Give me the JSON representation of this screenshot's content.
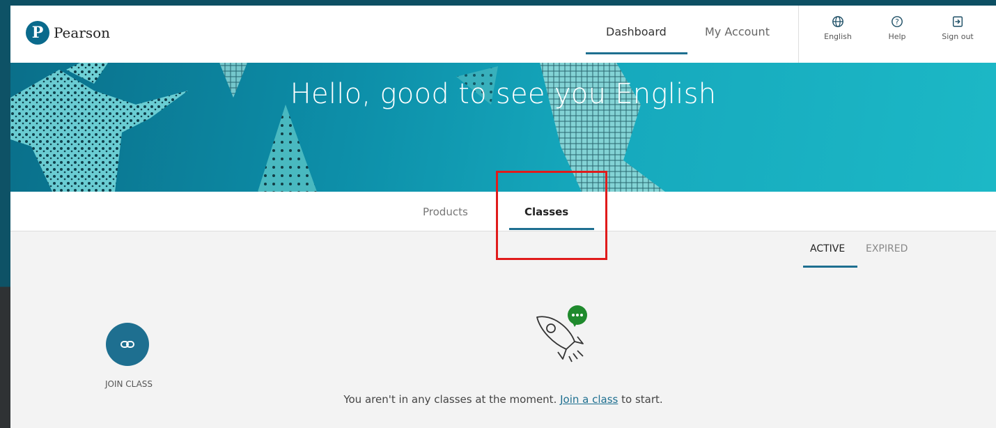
{
  "header": {
    "brand": "Pearson",
    "brand_letter": "P",
    "nav": {
      "dashboard": "Dashboard",
      "my_account": "My Account"
    },
    "utilities": {
      "language": "English",
      "help": "Help",
      "sign_out": "Sign out"
    }
  },
  "banner": {
    "greeting": "Hello, good to see you English"
  },
  "tabs": {
    "products": "Products",
    "classes": "Classes",
    "selected": "Classes"
  },
  "filters": {
    "active": "ACTIVE",
    "expired": "EXPIRED",
    "selected": "ACTIVE"
  },
  "join": {
    "label": "JOIN CLASS"
  },
  "empty_state": {
    "before": "You aren't in any classes at the moment. ",
    "link": "Join a class",
    "after": " to start."
  },
  "colors": {
    "accent": "#1e6f90",
    "highlight_box": "#e01b1b",
    "chat_badge": "#1f8a2d"
  }
}
